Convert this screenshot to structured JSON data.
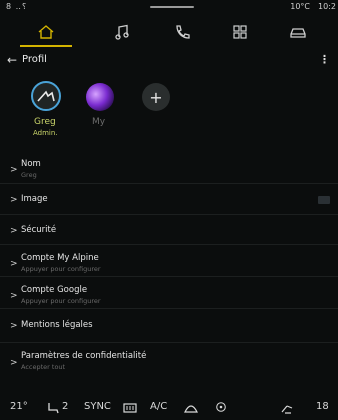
{
  "statusbar": {
    "signal": "8 ‥⸮",
    "temperature": "10°C",
    "time": "10:2"
  },
  "nav": {
    "items": [
      {
        "name": "home",
        "icon": "home-icon",
        "active": true
      },
      {
        "name": "music",
        "icon": "music-note-icon",
        "active": false
      },
      {
        "name": "phone",
        "icon": "phone-icon",
        "active": false
      },
      {
        "name": "apps",
        "icon": "apps-grid-icon",
        "active": false
      },
      {
        "name": "vehicle",
        "icon": "car-icon",
        "active": false
      }
    ],
    "accent": "#d4b400"
  },
  "header": {
    "back": "←",
    "title": "Profil",
    "menu": "⋮"
  },
  "profiles": {
    "greg": {
      "name": "Greg",
      "role": "Admin."
    },
    "my": {
      "name": "My"
    },
    "add_label": "+"
  },
  "list": [
    {
      "label": "Nom",
      "sub": "Greg"
    },
    {
      "label": "Image",
      "sub": ""
    },
    {
      "label": "Sécurité",
      "sub": ""
    },
    {
      "label": "Compte My Alpine",
      "sub": "Appuyer pour configurer"
    },
    {
      "label": "Compte Google",
      "sub": "Appuyer pour configurer"
    },
    {
      "label": "Mentions légales",
      "sub": ""
    },
    {
      "label": "Paramètres de confidentialité",
      "sub": "Accepter tout"
    }
  ],
  "chevron": ">",
  "bottombar": {
    "temp_left": "21°",
    "seat_heat": "2",
    "sync": "SYNC",
    "ac": "A/C",
    "temp_right": "18"
  },
  "colors": {
    "accent_blue": "#4aa3d8",
    "accent_green": "#c9d46a"
  }
}
